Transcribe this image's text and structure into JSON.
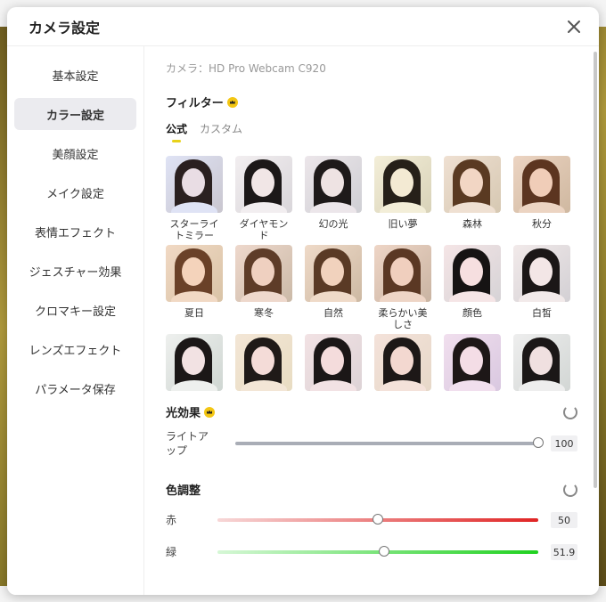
{
  "dialog": {
    "title": "カメラ設定",
    "close_icon": "close-icon"
  },
  "sidebar": {
    "items": [
      {
        "label": "基本設定",
        "active": false
      },
      {
        "label": "カラー設定",
        "active": true
      },
      {
        "label": "美顔設定",
        "active": false
      },
      {
        "label": "メイク設定",
        "active": false
      },
      {
        "label": "表情エフェクト",
        "active": false
      },
      {
        "label": "ジェスチャー効果",
        "active": false
      },
      {
        "label": "クロマキー設定",
        "active": false
      },
      {
        "label": "レンズエフェクト",
        "active": false
      },
      {
        "label": "パラメータ保存",
        "active": false
      }
    ]
  },
  "main": {
    "camera_label": "カメラ：HD Pro Webcam C920",
    "filter": {
      "title": "フィルター",
      "tabs": [
        {
          "label": "公式",
          "active": true
        },
        {
          "label": "カスタム",
          "active": false
        }
      ],
      "items": [
        {
          "name": "スターライトミラー",
          "hair": "#2a2020",
          "skin": "#e9dde4",
          "bg": "#c9c6cf",
          "tint": "#dfe3f5"
        },
        {
          "name": "ダイヤモンド",
          "hair": "#1c1818",
          "skin": "#f1e6e6",
          "bg": "#d9d6da",
          "tint": "#f2eef0"
        },
        {
          "name": "幻の光",
          "hair": "#1e1a1a",
          "skin": "#eee3e3",
          "bg": "#cfcfd4",
          "tint": "#ece6ea"
        },
        {
          "name": "旧い夢",
          "hair": "#262019",
          "skin": "#f3ead3",
          "bg": "#d8d2b8",
          "tint": "#f3eed8"
        },
        {
          "name": "森林",
          "hair": "#5a3a22",
          "skin": "#f2d6c4",
          "bg": "#d6c8b2",
          "tint": "#efe0d2"
        },
        {
          "name": "秋分",
          "hair": "#5c3520",
          "skin": "#f0cdb8",
          "bg": "#cfb8a0",
          "tint": "#ecd4c2"
        },
        {
          "name": "夏日",
          "hair": "#6a4128",
          "skin": "#f4d3bb",
          "bg": "#d9c3a6",
          "tint": "#f1d9c4"
        },
        {
          "name": "寒冬",
          "hair": "#5e3c28",
          "skin": "#efd0c0",
          "bg": "#cbbaa8",
          "tint": "#eed8cc"
        },
        {
          "name": "自然",
          "hair": "#5a3a25",
          "skin": "#f1d2bd",
          "bg": "#cdb9a3",
          "tint": "#efdac8"
        },
        {
          "name": "柔らかい美しさ",
          "hair": "#5b3824",
          "skin": "#f0cfbe",
          "bg": "#c9b4a2",
          "tint": "#eed5c6"
        },
        {
          "name": "顔色",
          "hair": "#161313",
          "skin": "#f6dfe0",
          "bg": "#d6d3d6",
          "tint": "#f5e5e6"
        },
        {
          "name": "白皙",
          "hair": "#1b1717",
          "skin": "#f3e6e6",
          "bg": "#d3d0d4",
          "tint": "#f2eaea"
        },
        {
          "name": "",
          "hair": "#1b1717",
          "skin": "#f2e2e3",
          "bg": "#cfd6d2",
          "tint": "#eef0ee"
        },
        {
          "name": "",
          "hair": "#1f1a18",
          "skin": "#f4dcd8",
          "bg": "#e8dcc2",
          "tint": "#f3e6d6"
        },
        {
          "name": "",
          "hair": "#1b1717",
          "skin": "#f4dcdc",
          "bg": "#ddd3d6",
          "tint": "#f2e2e4"
        },
        {
          "name": "",
          "hair": "#1d1817",
          "skin": "#f3d8d0",
          "bg": "#e6d8c8",
          "tint": "#f4e2da"
        },
        {
          "name": "",
          "hair": "#1d1717",
          "skin": "#f4dde6",
          "bg": "#d9c8e0",
          "tint": "#f1dfee"
        },
        {
          "name": "",
          "hair": "#1b1717",
          "skin": "#f0e0e0",
          "bg": "#d2d6d4",
          "tint": "#eeeeee"
        }
      ]
    },
    "light_effect": {
      "title": "光効果",
      "slider": {
        "label": "ライトアップ",
        "value": "100",
        "fraction": 1.0,
        "track": "#a9adb6"
      }
    },
    "color_adjust": {
      "title": "色調整",
      "sliders": [
        {
          "label": "赤",
          "value": "50",
          "fraction": 0.5,
          "from": "#f7d7d7",
          "to": "#e02424"
        },
        {
          "label": "緑",
          "value": "51.9",
          "fraction": 0.519,
          "from": "#d6f7d6",
          "to": "#1fd11f"
        }
      ]
    }
  },
  "colors": {
    "accent": "#f3c613",
    "active_sidebar_bg": "#ebebef"
  }
}
